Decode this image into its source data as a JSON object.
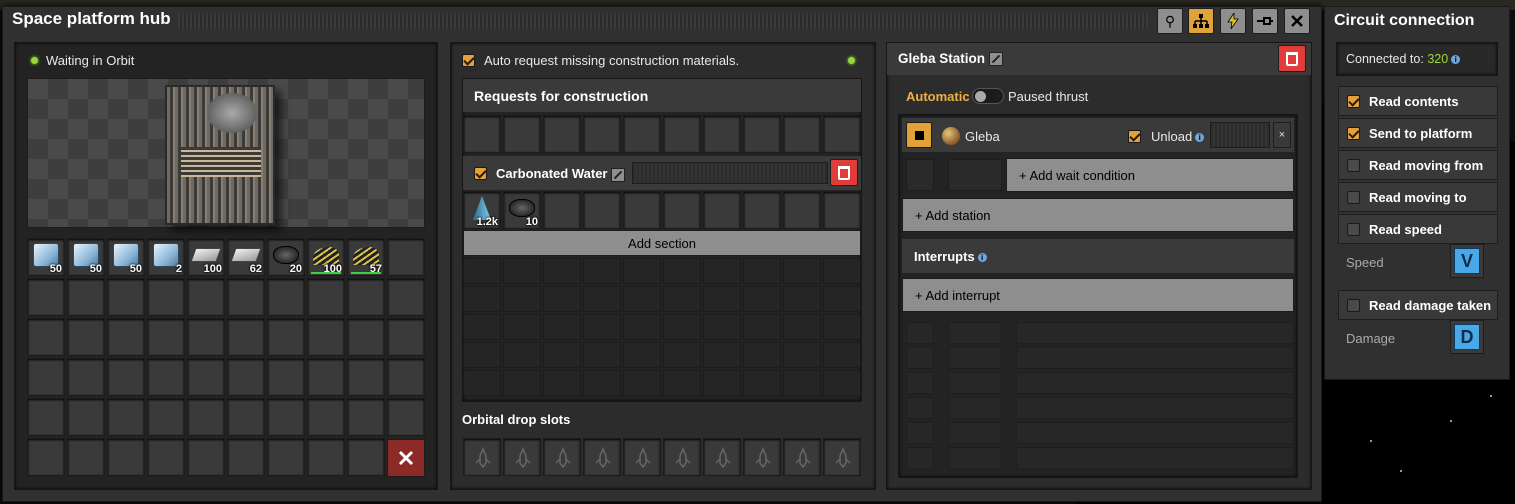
{
  "window": {
    "title": "Space platform hub",
    "accent": "#e0a33a"
  },
  "toolbar": {
    "search_icon": "magnifier-icon",
    "network_icon": "circuit-network-icon",
    "power_icon": "lightning-icon",
    "pin_icon": "pin-icon",
    "close_icon": "close-icon"
  },
  "status": {
    "text": "Waiting in Orbit"
  },
  "inventory": {
    "items": [
      {
        "icon": "ice",
        "count": "50"
      },
      {
        "icon": "ice",
        "count": "50"
      },
      {
        "icon": "ice",
        "count": "50"
      },
      {
        "icon": "ice",
        "count": "2"
      },
      {
        "icon": "metal-plate",
        "count": "100"
      },
      {
        "icon": "metal-plate",
        "count": "62"
      },
      {
        "icon": "carbon",
        "count": "20"
      },
      {
        "icon": "rail",
        "count": "100"
      },
      {
        "icon": "rail",
        "count": "57"
      }
    ]
  },
  "construction": {
    "auto_request": "Auto request missing construction materials.",
    "requests_title": "Requests for construction",
    "section_name": "Carbonated Water",
    "section_items": [
      {
        "icon": "science-cone",
        "count": "1.2k"
      },
      {
        "icon": "carbon",
        "count": "10"
      }
    ],
    "add_section": "Add section",
    "orbital_drop": "Orbital drop slots"
  },
  "schedule": {
    "station_name": "Gleba Station",
    "mode": "Automatic",
    "paused_thrust": "Paused thrust",
    "stop_name": "Gleba",
    "unload": "Unload",
    "add_wait": "+ Add wait condition",
    "add_station": "+ Add station",
    "interrupts": "Interrupts",
    "add_interrupt": "+ Add interrupt"
  },
  "circuit": {
    "title": "Circuit connection",
    "connected_label": "Connected to:",
    "connected_value": "320",
    "options": [
      {
        "label": "Read contents",
        "checked": true
      },
      {
        "label": "Send to platform",
        "checked": true
      },
      {
        "label": "Read moving from",
        "checked": false
      },
      {
        "label": "Read moving to",
        "checked": false
      },
      {
        "label": "Read speed",
        "checked": false
      }
    ],
    "speed_label": "Speed",
    "speed_signal": "V",
    "damage_option": "Read damage taken",
    "damage_label": "Damage",
    "damage_signal": "D"
  }
}
